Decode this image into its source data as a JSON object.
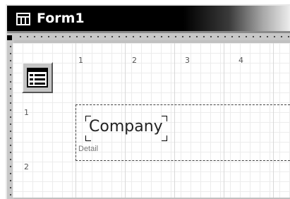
{
  "window": {
    "title": "Form1",
    "title_icon": "form-icon"
  },
  "ruler": {
    "horizontal_numbers": [
      "1",
      "2",
      "3",
      "4"
    ],
    "vertical_numbers": [
      "1",
      "2"
    ]
  },
  "toolbox": {
    "selector_icon": "form-selector-icon"
  },
  "sections": [
    {
      "label": "Detail"
    }
  ],
  "controls": [
    {
      "type": "label",
      "text": "Company"
    }
  ]
}
